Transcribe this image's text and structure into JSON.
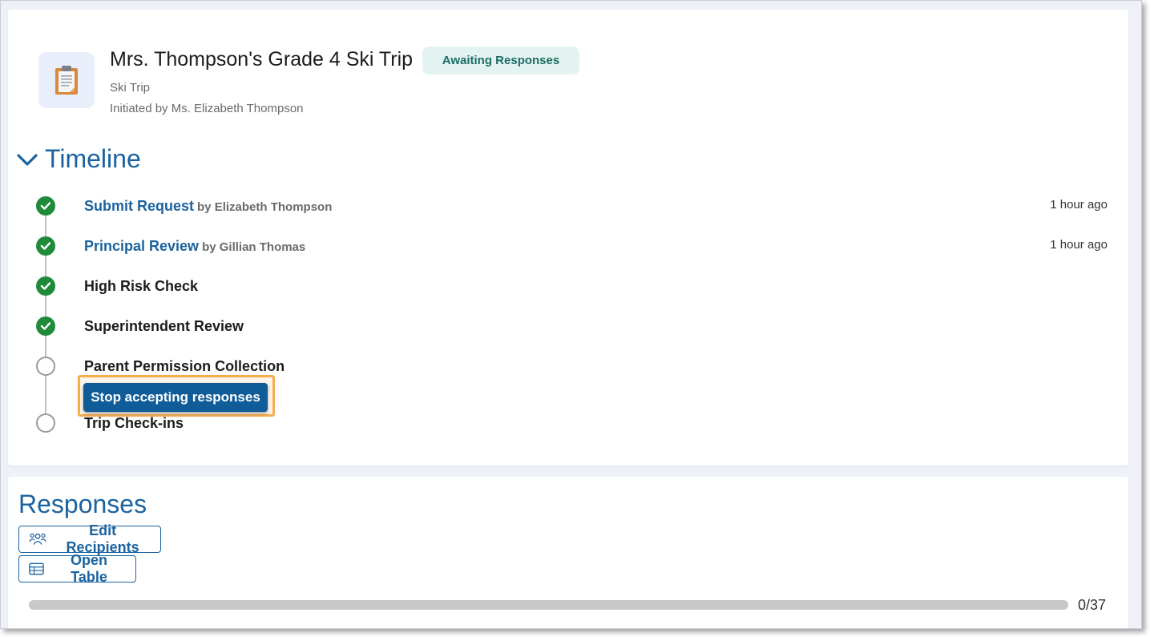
{
  "header": {
    "title": "Mrs. Thompson's Grade 4 Ski Trip",
    "status": "Awaiting Responses",
    "type": "Ski Trip",
    "initiated_by": "Initiated by Ms. Elizabeth Thompson",
    "icon": "clipboard-icon"
  },
  "timeline": {
    "title": "Timeline",
    "toggle_icon": "chevron-down-icon",
    "steps": [
      {
        "label": "Submit Request",
        "by": "by Elizabeth Thompson",
        "time": "1 hour ago",
        "status": "done"
      },
      {
        "label": "Principal Review",
        "by": "by Gillian Thomas",
        "time": "1 hour ago",
        "status": "done"
      },
      {
        "label": "High Risk Check",
        "status": "done"
      },
      {
        "label": "Superintendent Review",
        "status": "done"
      },
      {
        "label": "Parent Permission Collection",
        "status": "pending"
      },
      {
        "label": "Trip Check-ins",
        "status": "pending"
      }
    ],
    "action_button": "Stop accepting responses"
  },
  "responses": {
    "title": "Responses",
    "edit_recipients": "Edit Recipients",
    "open_table": "Open Table",
    "progress": {
      "count_label": "0/37",
      "received": 0,
      "total": 37
    }
  },
  "colors": {
    "accent": "#1b63a0",
    "done": "#1e8a3a",
    "badge_bg": "#e2f3f2",
    "badge_text": "#1d6d63",
    "highlight": "#f4ad4f",
    "primary_button": "#0f5c99"
  }
}
